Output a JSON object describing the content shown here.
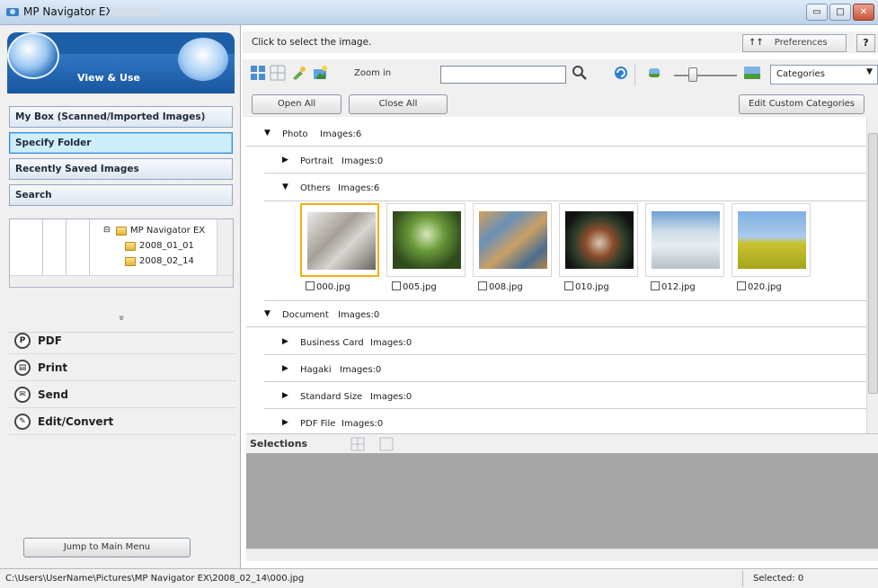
{
  "window": {
    "title": "MP Navigator EX"
  },
  "left": {
    "banner_label": "View & Use",
    "nav": [
      {
        "label": "My Box (Scanned/Imported Images)"
      },
      {
        "label": "Specify Folder"
      },
      {
        "label": "Recently Saved Images"
      },
      {
        "label": "Search"
      }
    ],
    "tree": {
      "root": "MP Navigator EX",
      "children": [
        "2008_01_01",
        "2008_02_14"
      ]
    },
    "collapse": "»",
    "actions": [
      {
        "label": "PDF",
        "icon": "pdf-icon"
      },
      {
        "label": "Print",
        "icon": "print-icon"
      },
      {
        "label": "Send",
        "icon": "send-icon"
      },
      {
        "label": "Edit/Convert",
        "icon": "edit-convert-icon"
      }
    ],
    "jump_label": "Jump to Main Menu"
  },
  "header": {
    "message": "Click to select the image.",
    "prefs_label": "Preferences",
    "help_label": "?"
  },
  "toolbar": {
    "zoom_label": "Zoom in",
    "search_value": "",
    "category_select": "Categories"
  },
  "buttons": {
    "open_all": "Open All",
    "close_all": "Close All",
    "edit_categories": "Edit Custom Categories"
  },
  "content": {
    "photo": {
      "label": "Photo",
      "count": "Images:6"
    },
    "portrait": {
      "label": "Portrait",
      "count": "Images:0"
    },
    "others": {
      "label": "Others",
      "count": "Images:6"
    },
    "images": [
      "000.jpg",
      "005.jpg",
      "008.jpg",
      "010.jpg",
      "012.jpg",
      "020.jpg"
    ],
    "document": {
      "label": "Document",
      "count": "Images:0"
    },
    "business_card": {
      "label": "Business Card",
      "count": "Images:0"
    },
    "hagaki": {
      "label": "Hagaki",
      "count": "Images:0"
    },
    "standard_size": {
      "label": "Standard Size",
      "count": "Images:0"
    },
    "pdf_file": {
      "label": "PDF File",
      "count": "Images:0"
    }
  },
  "selections_label": "Selections",
  "status": {
    "path": "C:\\Users\\UserName\\Pictures\\MP Navigator EX\\2008_02_14\\000.jpg",
    "selected": "Selected: 0"
  },
  "colors": {
    "accent": "#1c5fa6",
    "selection": "#f2b00e",
    "selected_nav": "#cfeefc"
  }
}
